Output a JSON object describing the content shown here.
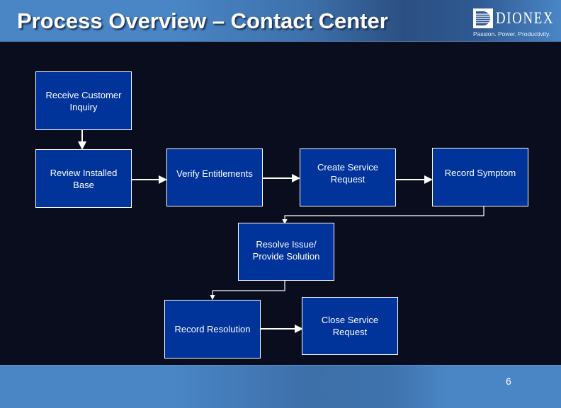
{
  "header": {
    "title": "Process Overview – Contact Center",
    "logo": {
      "wordmark": "DIONEX",
      "tagline": "Passion. Power. Productivity.",
      "icon": "dionex-d-icon"
    }
  },
  "diagram": {
    "nodes": [
      {
        "id": "receive",
        "label": "Receive Customer Inquiry"
      },
      {
        "id": "review",
        "label": "Review Installed Base"
      },
      {
        "id": "verify",
        "label": "Verify Entitlements"
      },
      {
        "id": "create",
        "label": "Create Service Request"
      },
      {
        "id": "symptom",
        "label": "Record Symptom"
      },
      {
        "id": "resolve",
        "label": "Resolve Issue/ Provide Solution"
      },
      {
        "id": "resolution",
        "label": "Record Resolution"
      },
      {
        "id": "close",
        "label": "Close Service Request"
      }
    ],
    "edges": [
      {
        "from": "receive",
        "to": "review"
      },
      {
        "from": "review",
        "to": "verify"
      },
      {
        "from": "verify",
        "to": "create"
      },
      {
        "from": "create",
        "to": "symptom"
      },
      {
        "from": "symptom",
        "to": "resolve"
      },
      {
        "from": "resolve",
        "to": "resolution"
      },
      {
        "from": "resolution",
        "to": "close"
      }
    ]
  },
  "footer": {
    "page_number": "6"
  }
}
